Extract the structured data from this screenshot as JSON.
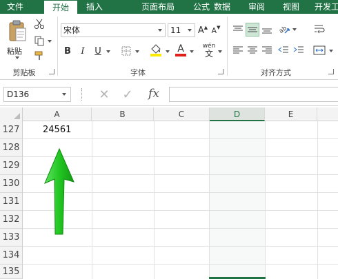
{
  "ribbon_tabs": [
    "文件",
    "开始",
    "插入",
    "页面布局",
    "公式",
    "数据",
    "审阅",
    "视图",
    "开发工"
  ],
  "active_tab": "开始",
  "clipboard": {
    "paste_label": "粘贴",
    "group_label": "剪贴板"
  },
  "font": {
    "name": "宋体",
    "size": "11",
    "bold": "B",
    "italic": "I",
    "underline": "U",
    "grow": "A",
    "shrink": "A",
    "font_color_glyph": "A",
    "wen": "wén",
    "group_label": "字体"
  },
  "alignment": {
    "group_label": "对齐方式"
  },
  "formula_bar": {
    "name_box": "D136",
    "cancel_glyph": "✕",
    "enter_glyph": "✓",
    "fx_label": "fx",
    "formula": ""
  },
  "columns": [
    "A",
    "B",
    "C",
    "D",
    "E"
  ],
  "selected_column": "D",
  "rows": [
    "127",
    "128",
    "129",
    "130",
    "131",
    "132",
    "133",
    "134",
    "135"
  ],
  "cells": {
    "A127": "24561"
  },
  "colors": {
    "brand": "#217346",
    "arrow": "#2fcf2f",
    "font_color_bar": "#e0201a",
    "fill_bar": "#ffeb00"
  },
  "icons": [
    "scissors-icon",
    "copy-icon",
    "format-painter-icon",
    "paste-icon",
    "borders-icon",
    "fill-color-icon",
    "align-top-icon",
    "align-middle-icon",
    "align-bottom-icon",
    "orientation-icon",
    "wrap-text-icon",
    "merge-center-icon"
  ]
}
